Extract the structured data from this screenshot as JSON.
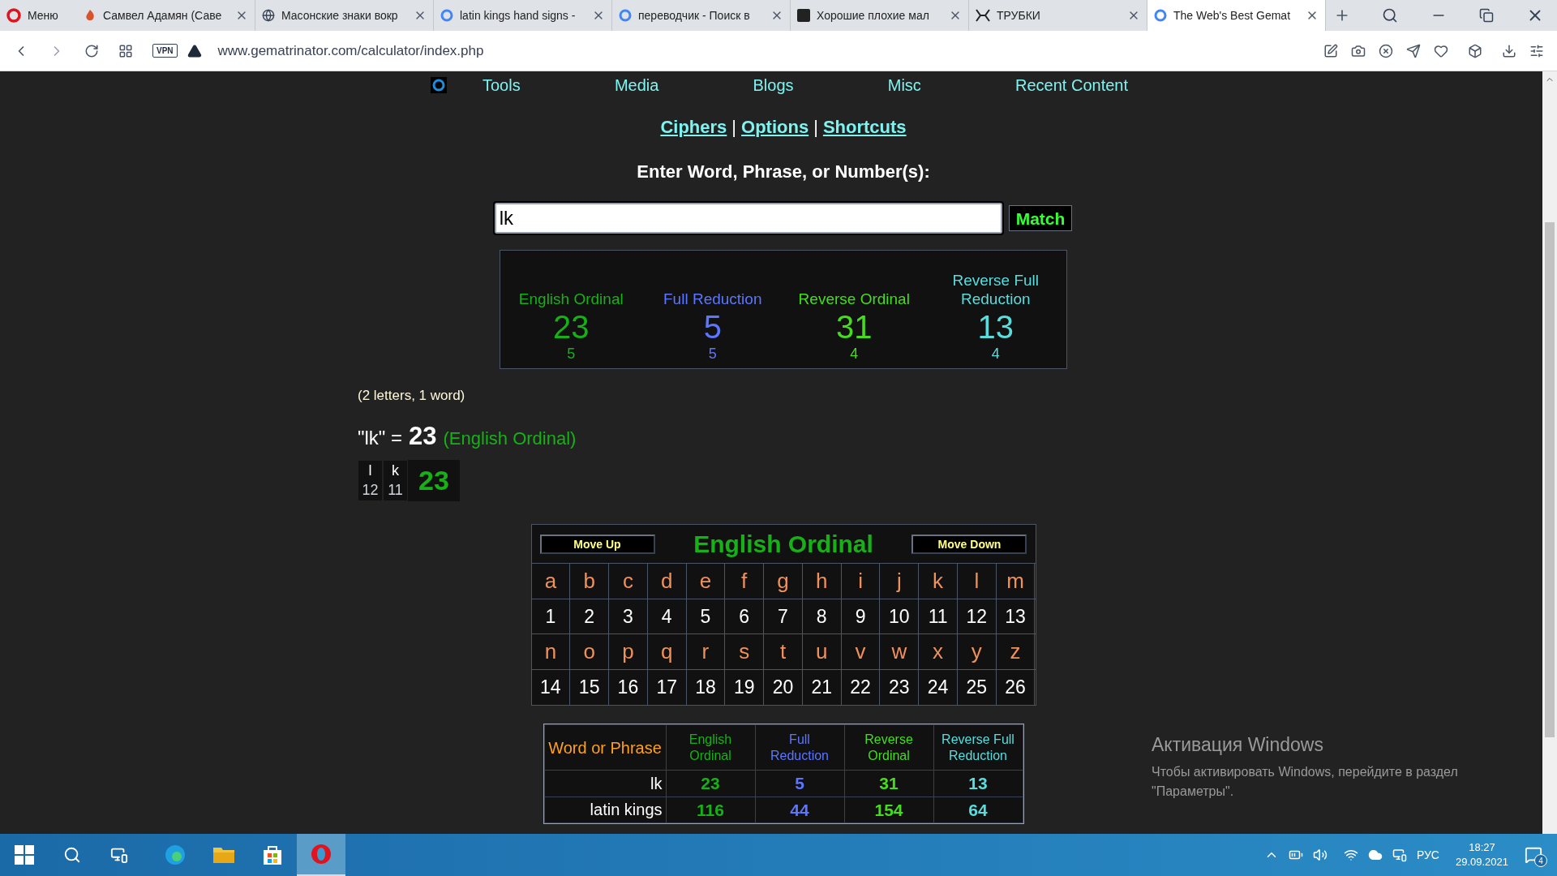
{
  "browser": {
    "menu": "Меню",
    "tabs": [
      {
        "title": "Самвел Адамян (Саве",
        "selected": false
      },
      {
        "title": "Масонские знаки вокр",
        "selected": false
      },
      {
        "title": "latin kings hand signs -",
        "selected": false
      },
      {
        "title": "переводчик - Поиск в",
        "selected": false
      },
      {
        "title": "Хорошие плохие мал",
        "selected": false
      },
      {
        "title": "ТРУБКИ",
        "selected": false
      },
      {
        "title": "The Web's Best Gemat",
        "selected": true
      }
    ],
    "vpn": "VPN",
    "url": "www.gematrinator.com/calculator/index.php"
  },
  "nav": [
    "Tools",
    "Media",
    "Blogs",
    "Misc",
    "Recent Content"
  ],
  "links": [
    {
      "kind": "link",
      "text": "Ciphers"
    },
    {
      "kind": "separator",
      "text": "|"
    },
    {
      "kind": "link",
      "text": "Options"
    },
    {
      "kind": "separator",
      "text": "|"
    },
    {
      "kind": "link",
      "text": "Shortcuts"
    }
  ],
  "prompt": "Enter Word, Phrase, or Number(s):",
  "input": {
    "value": "lk"
  },
  "match_button": "Match",
  "results": [
    {
      "name": "English Ordinal",
      "value": "23",
      "sub": "5",
      "color": "#17b117"
    },
    {
      "name": "Full Reduction",
      "value": "5",
      "sub": "5",
      "color": "#5c76ff"
    },
    {
      "name": "Reverse Ordinal",
      "value": "31",
      "sub": "4",
      "color": "#46dc1e"
    },
    {
      "name": "Reverse Full Reduction",
      "value": "13",
      "sub": "4",
      "color": "#5adcdc"
    }
  ],
  "summary": "(2 letters, 1 word)",
  "equation": {
    "word": "\"lk\" =",
    "value": "23",
    "cipher": "(English Ordinal)"
  },
  "breakdown": {
    "letters": [
      {
        "letter": "l",
        "value": "12"
      },
      {
        "letter": "k",
        "value": "11"
      }
    ],
    "total": "23"
  },
  "cipher_table": {
    "title": "English Ordinal",
    "move_up": "Move Up",
    "move_down": "Move Down",
    "cells": [
      {
        "letter": "a",
        "value": "1"
      },
      {
        "letter": "b",
        "value": "2"
      },
      {
        "letter": "c",
        "value": "3"
      },
      {
        "letter": "d",
        "value": "4"
      },
      {
        "letter": "e",
        "value": "5"
      },
      {
        "letter": "f",
        "value": "6"
      },
      {
        "letter": "g",
        "value": "7"
      },
      {
        "letter": "h",
        "value": "8"
      },
      {
        "letter": "i",
        "value": "9"
      },
      {
        "letter": "j",
        "value": "10"
      },
      {
        "letter": "k",
        "value": "11"
      },
      {
        "letter": "l",
        "value": "12"
      },
      {
        "letter": "m",
        "value": "13"
      },
      {
        "letter": "n",
        "value": "14"
      },
      {
        "letter": "o",
        "value": "15"
      },
      {
        "letter": "p",
        "value": "16"
      },
      {
        "letter": "q",
        "value": "17"
      },
      {
        "letter": "r",
        "value": "18"
      },
      {
        "letter": "s",
        "value": "19"
      },
      {
        "letter": "t",
        "value": "20"
      },
      {
        "letter": "u",
        "value": "21"
      },
      {
        "letter": "v",
        "value": "22"
      },
      {
        "letter": "w",
        "value": "23"
      },
      {
        "letter": "x",
        "value": "24"
      },
      {
        "letter": "y",
        "value": "25"
      },
      {
        "letter": "z",
        "value": "26"
      }
    ]
  },
  "history": {
    "phrase_header": "Word or Phrase",
    "columns": [
      {
        "label": "English Ordinal",
        "color": "#17b117"
      },
      {
        "label": "Full Reduction",
        "color": "#5c76ff"
      },
      {
        "label": "Reverse Ordinal",
        "color": "#46dc1e"
      },
      {
        "label": "Reverse Full Reduction",
        "color": "#5adcdc"
      }
    ],
    "rows": [
      {
        "phrase": "lk",
        "values": [
          "23",
          "5",
          "31",
          "13"
        ]
      },
      {
        "phrase": "latin kings",
        "values": [
          "116",
          "44",
          "154",
          "64"
        ]
      }
    ]
  },
  "activation": {
    "title": "Активация Windows",
    "text": "Чтобы активировать Windows, перейдите в раздел \"Параметры\"."
  },
  "taskbar": {
    "apps": [
      {
        "kind": "edge",
        "selected": false
      },
      {
        "kind": "explorer",
        "selected": false
      },
      {
        "kind": "store",
        "selected": false
      },
      {
        "kind": "opera",
        "selected": true
      }
    ],
    "language": "РУС",
    "time": "18:27",
    "date": "29.09.2021",
    "notifications": "4"
  }
}
